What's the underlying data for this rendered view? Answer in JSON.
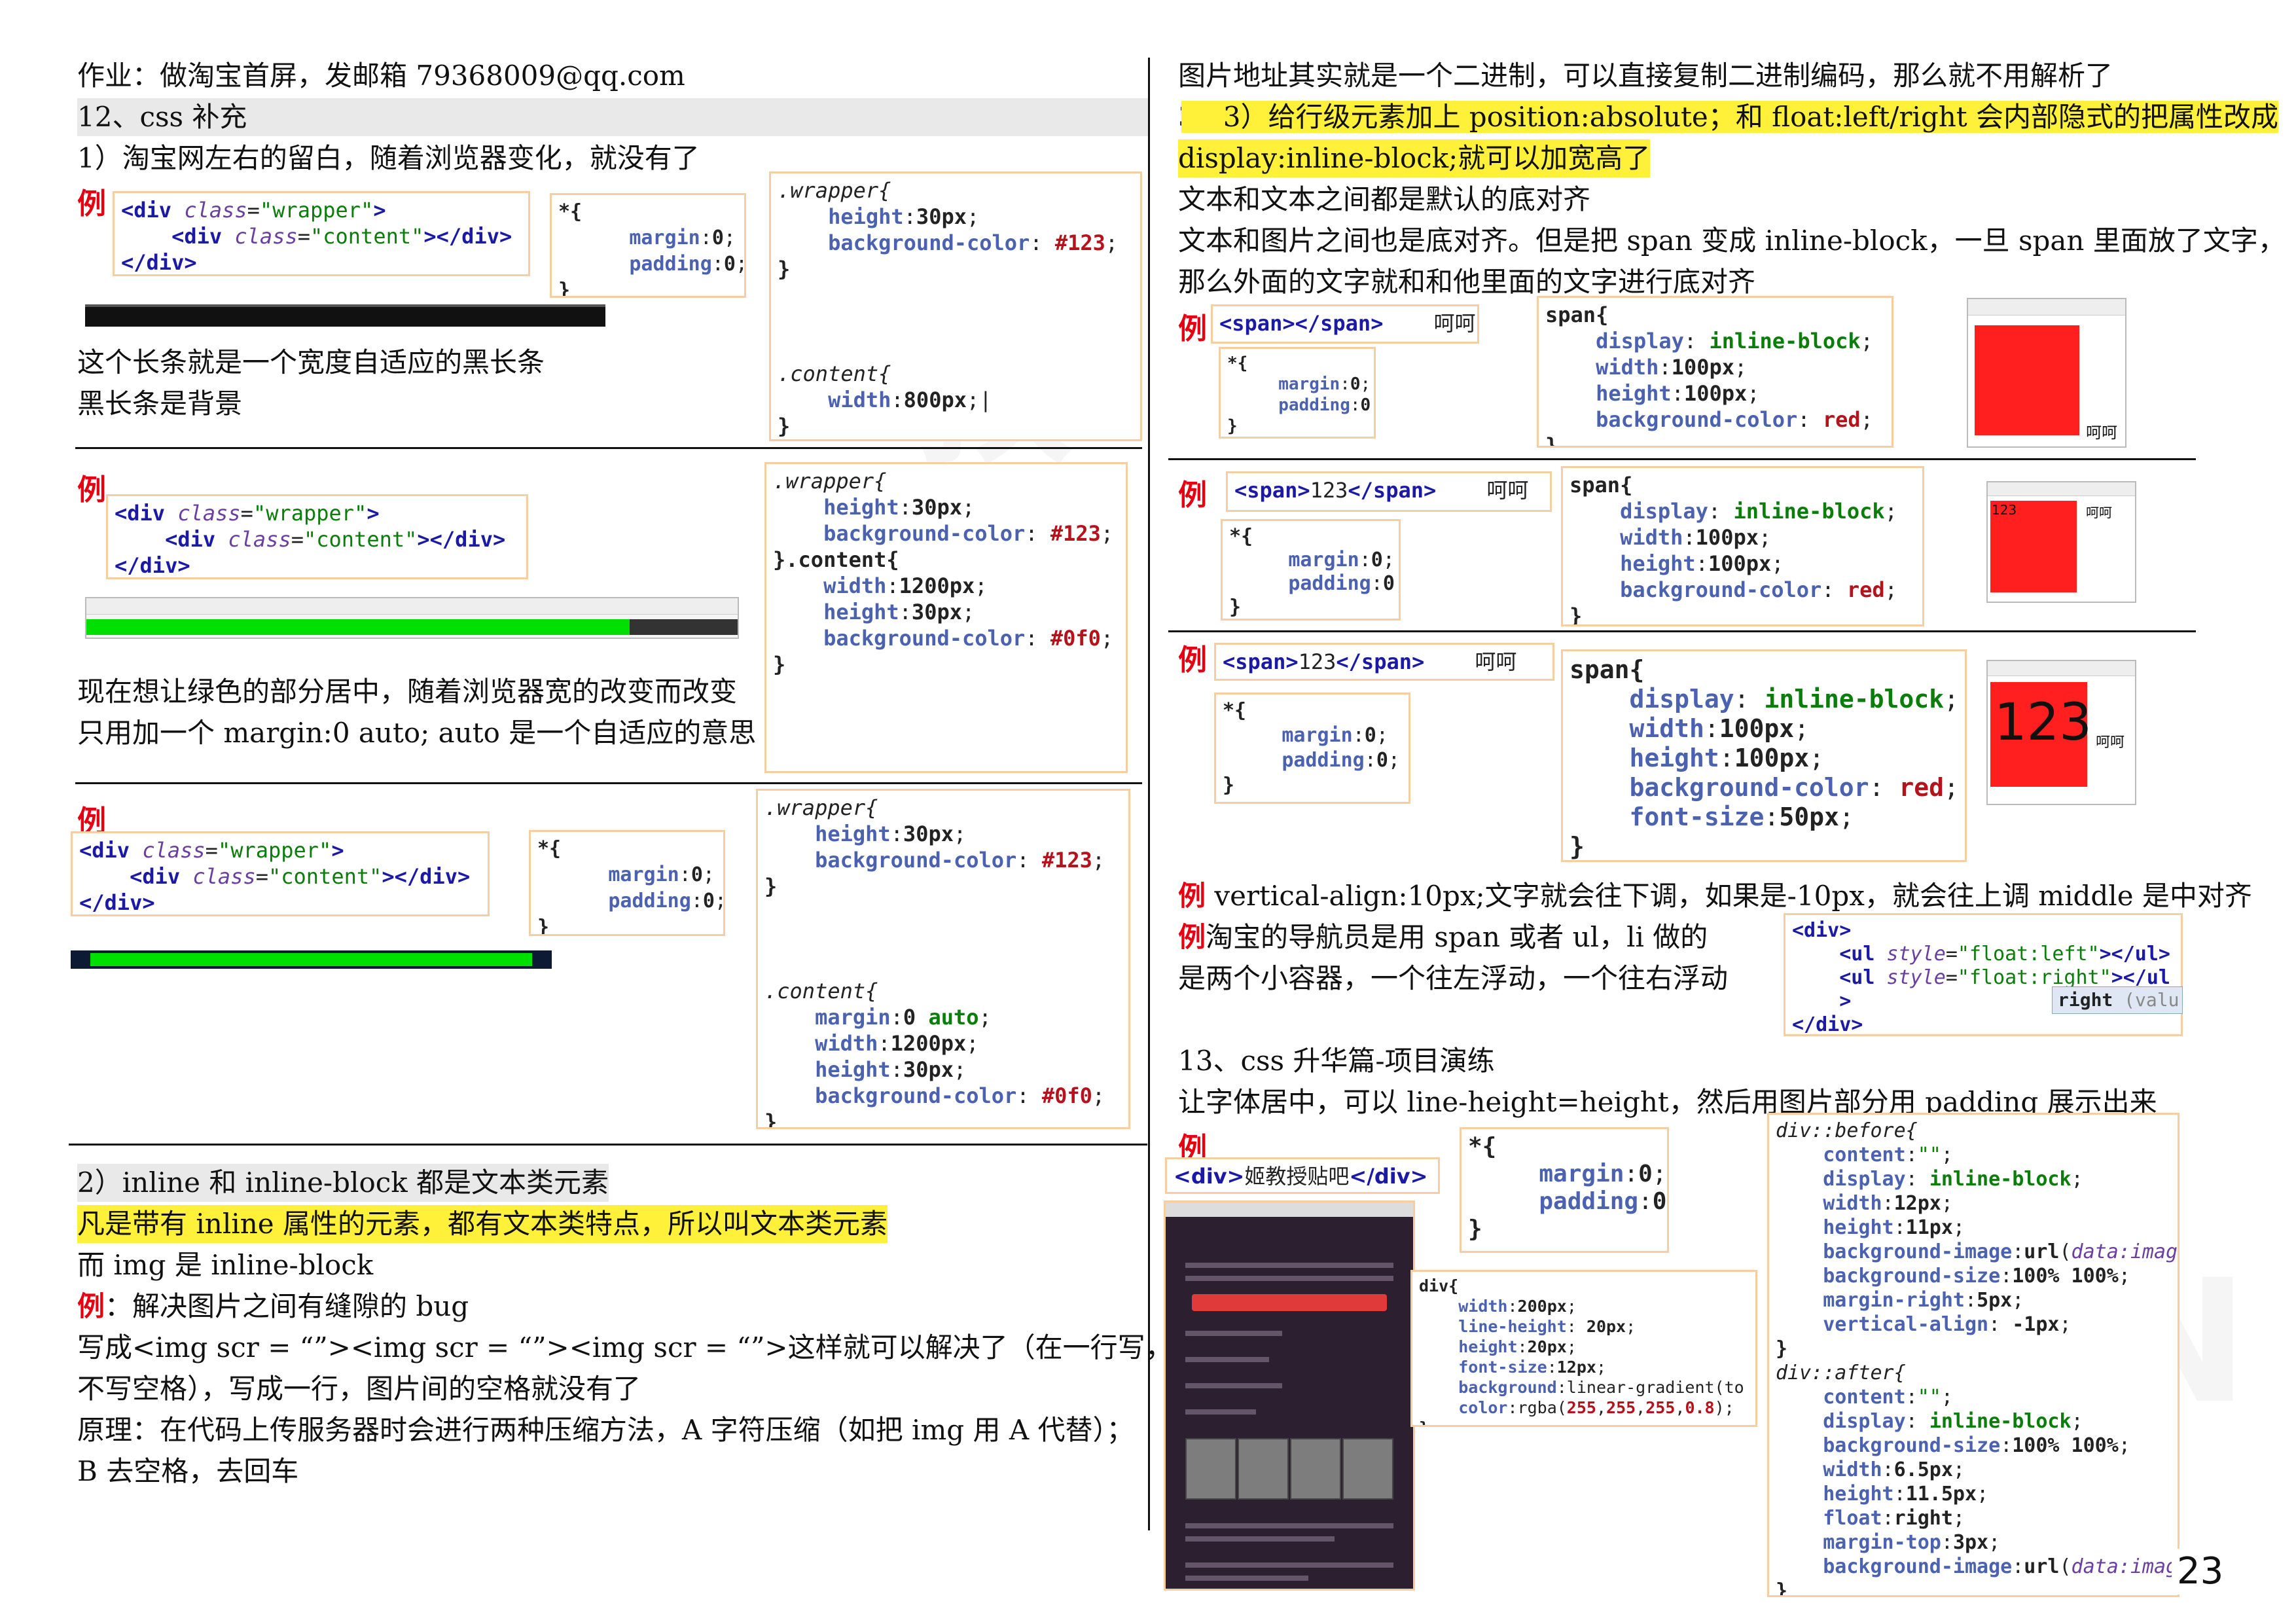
{
  "left": {
    "line1": "作业：做淘宝首屏，发邮箱 79368009@qq.com",
    "line2": "12、css 补充",
    "line3": "1）淘宝网左右的留白，随着浏览器变化，就没有了",
    "ex_label": "例",
    "line4": "这个长条就是一个宽度自适应的黑长条",
    "line5": "黑长条是背景",
    "line6": "现在想让绿色的部分居中，随着浏览器宽的改变而改变",
    "line7": "只用加一个 margin:0 auto;      auto 是一个自适应的意思",
    "s2_line1": "2）inline 和 inline-block 都是文本类元素",
    "s2_line2": "凡是带有 inline 属性的元素，都有文本类特点，所以叫文本类元素",
    "s2_line3": "而 img 是 inline-block",
    "s2_line4_rest": "：解决图片之间有缝隙的 bug",
    "s2_line5": "写成<img scr = “”><img scr = “”><img scr = “”>这样就可以解决了（在一行写，并且",
    "s2_line6": "不写空格），写成一行，图片间的空格就没有了",
    "s2_line7": "原理：在代码上传服务器时会进行两种压缩方法，A 字符压缩（如把 img 用 A 代替）；",
    "s2_line8": "B 去空格，去回车"
  },
  "right": {
    "line1": "图片地址其实就是一个二进制，可以直接复制二进制编码，那么就不用解析了",
    "line2": "3）给行级元素加上 position:absolute；和 float:left/right 会内部隐式的把属性改成",
    "line3": "display:inline-block;就可以加宽高了",
    "line4": "文本和文本之间都是默认的底对齐",
    "line5": "文本和图片之间也是底对齐。但是把 span 变成 inline-block，一旦 span 里面放了文字，",
    "line6": "那么外面的文字就和和他里面的文字进行底对齐",
    "ex_label": "例",
    "hehe": "呵呵",
    "span123": "123",
    "line7_rest": " vertical-align:10px;文字就会往下调，如果是-10px，就会往上调 middle 是中对齐",
    "line8_rest": "淘宝的导航员是用 span 或者 ul，li 做的",
    "line9": "是两个小容器，一个往左浮动，一个往右浮动",
    "autocomplete_right": "right",
    "autocomplete_value": "(valu",
    "s13_title": "13、css 升华篇-项目演练",
    "s13_line1": "让字体居中，可以 line-height=height，然后用图片部分用 padding 展示出来"
  },
  "page_number": "23"
}
